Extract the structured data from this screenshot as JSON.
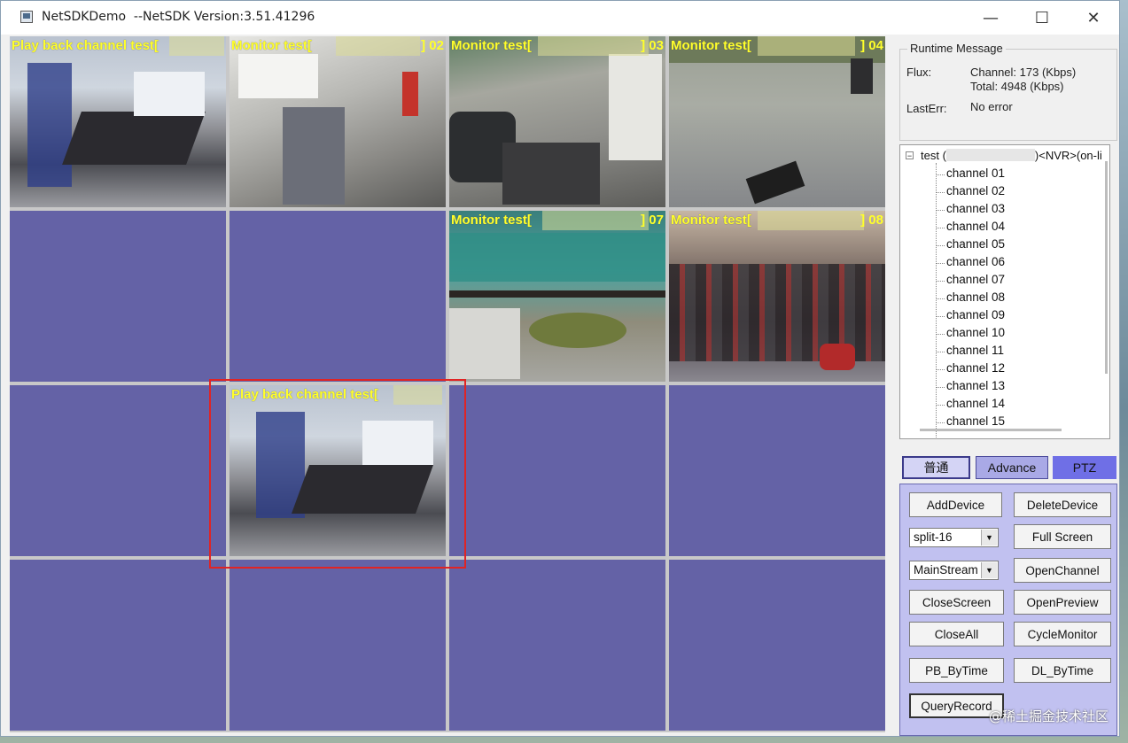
{
  "window": {
    "title": "NetSDKDemo  --NetSDK Version:3.51.41296",
    "minimize_glyph": "—",
    "maximize_glyph": "☐",
    "close_glyph": "✕"
  },
  "video_grid": {
    "cells": [
      {
        "label": "Play back channel test[",
        "num": ""
      },
      {
        "label": "Monitor test[",
        "num": "] 02"
      },
      {
        "label": "Monitor test[",
        "num": "] 03"
      },
      {
        "label": "Monitor test[",
        "num": "] 04"
      },
      {
        "label": "",
        "num": ""
      },
      {
        "label": "",
        "num": ""
      },
      {
        "label": "Monitor test[",
        "num": "] 07"
      },
      {
        "label": "Monitor test[",
        "num": "] 08"
      },
      {
        "label": "",
        "num": ""
      },
      {
        "label": "Play back channel test[",
        "num": ""
      },
      {
        "label": "",
        "num": ""
      },
      {
        "label": "",
        "num": ""
      },
      {
        "label": "",
        "num": ""
      },
      {
        "label": "",
        "num": ""
      },
      {
        "label": "",
        "num": ""
      },
      {
        "label": "",
        "num": ""
      }
    ]
  },
  "runtime": {
    "group_title": "Runtime Message",
    "flux_label": "Flux:",
    "flux_channel": "Channel: 173 (Kbps)",
    "flux_total": "Total: 4948 (Kbps)",
    "lasterr_label": "LastErr:",
    "lasterr_value": "No error"
  },
  "device_tree": {
    "root_label": "test (",
    "root_suffix": ")<NVR>(on-li",
    "channels": [
      "channel 01",
      "channel 02",
      "channel 03",
      "channel 04",
      "channel 05",
      "channel 06",
      "channel 07",
      "channel 08",
      "channel 09",
      "channel 10",
      "channel 11",
      "channel 12",
      "channel 13",
      "channel 14",
      "channel 15"
    ]
  },
  "tabs": {
    "normal": "普通",
    "advance": "Advance",
    "ptz": "PTZ"
  },
  "buttons": {
    "add_device": "AddDevice",
    "delete_device": "DeleteDevice",
    "split_value": "split-16",
    "full_screen": "Full Screen",
    "stream_value": "MainStream",
    "open_channel": "OpenChannel",
    "close_screen": "CloseScreen",
    "open_preview": "OpenPreview",
    "close_all": "CloseAll",
    "cycle_monitor": "CycleMonitor",
    "pb_bytime": "PB_ByTime",
    "dl_bytime": "DL_ByTime",
    "query_record": "QueryRecord"
  },
  "watermark": "@稀土掘金技术社区",
  "colors": {
    "empty_cell": "#6462a6",
    "osd_text": "#ffff2a",
    "highlight": "#e02424",
    "ptz_tab": "#6f6fe6"
  }
}
